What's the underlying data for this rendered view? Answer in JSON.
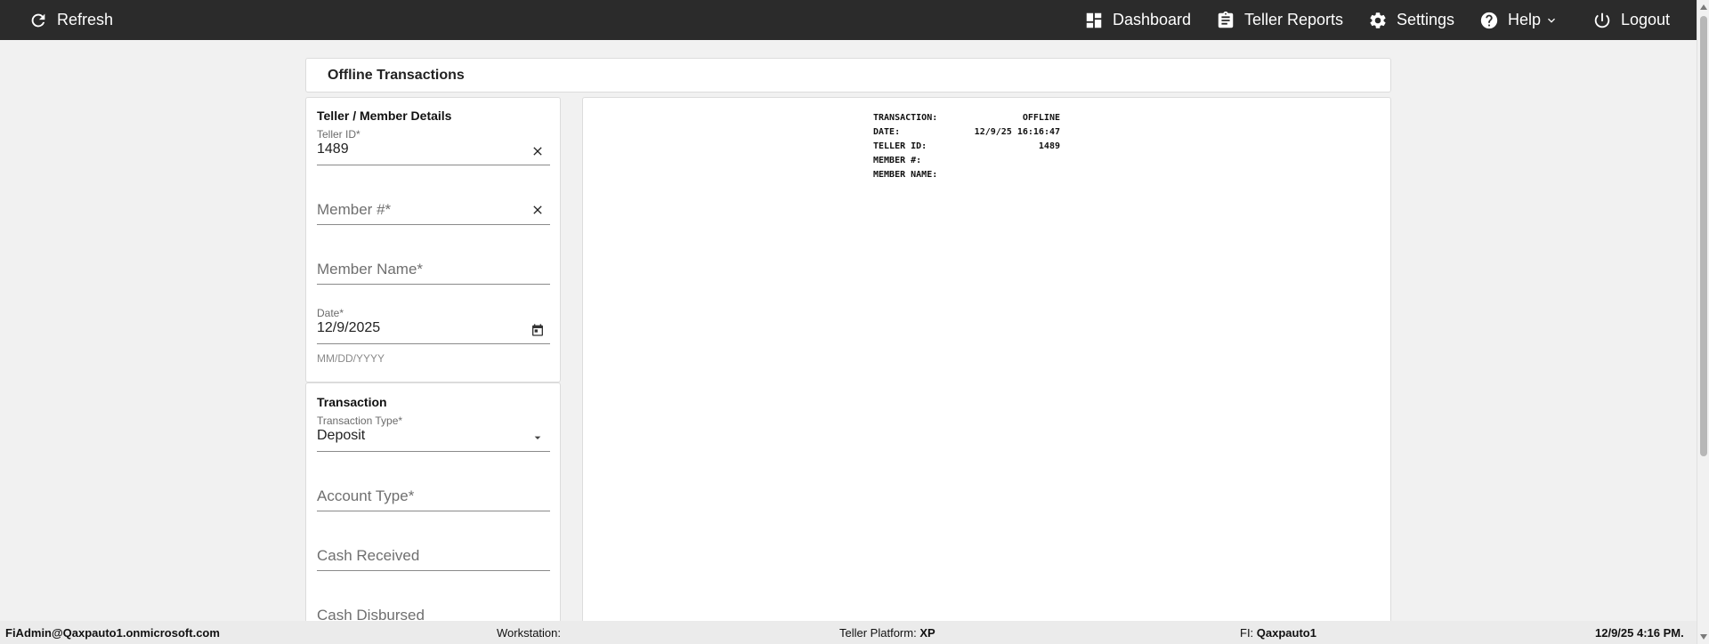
{
  "topbar": {
    "refresh_label": "Refresh",
    "dashboard_label": "Dashboard",
    "reports_label": "Teller Reports",
    "settings_label": "Settings",
    "help_label": "Help",
    "logout_label": "Logout"
  },
  "page": {
    "title": "Offline Transactions"
  },
  "details": {
    "title": "Teller / Member Details",
    "teller_id_label": "Teller ID*",
    "teller_id_value": "1489",
    "member_number_placeholder": "Member #*",
    "member_name_placeholder": "Member Name*",
    "date_label": "Date*",
    "date_value": "12/9/2025",
    "date_hint": "MM/DD/YYYY"
  },
  "transaction": {
    "title": "Transaction",
    "type_label": "Transaction Type*",
    "type_value": "Deposit",
    "account_type_placeholder": "Account Type*",
    "cash_received_placeholder": "Cash Received",
    "cash_disbursed_placeholder": "Cash Disbursed"
  },
  "receipt": {
    "rows": [
      {
        "label": "TRANSACTION:",
        "value": "OFFLINE"
      },
      {
        "label": "DATE:",
        "value": "12/9/25 16:16:47"
      },
      {
        "label": "TELLER ID:",
        "value": "1489"
      },
      {
        "label": "MEMBER #:",
        "value": ""
      },
      {
        "label": "MEMBER NAME:",
        "value": ""
      }
    ]
  },
  "footer": {
    "user": "FiAdmin@Qaxpauto1.onmicrosoft.com",
    "workstation_label": "Workstation:",
    "workstation_value": "",
    "platform_label": "Teller Platform:",
    "platform_value": "XP",
    "fi_label": "FI:",
    "fi_value": "Qaxpauto1",
    "datetime": "12/9/25 4:16 PM."
  },
  "icons": {
    "refresh": "refresh-icon",
    "dashboard": "dashboard-icon",
    "reports": "clipboard-icon",
    "settings": "gear-icon",
    "help": "help-circle-icon",
    "logout": "power-icon"
  },
  "colors": {
    "topbar": "#2b2b2b",
    "background": "#f1f1f1",
    "card": "#ffffff"
  }
}
